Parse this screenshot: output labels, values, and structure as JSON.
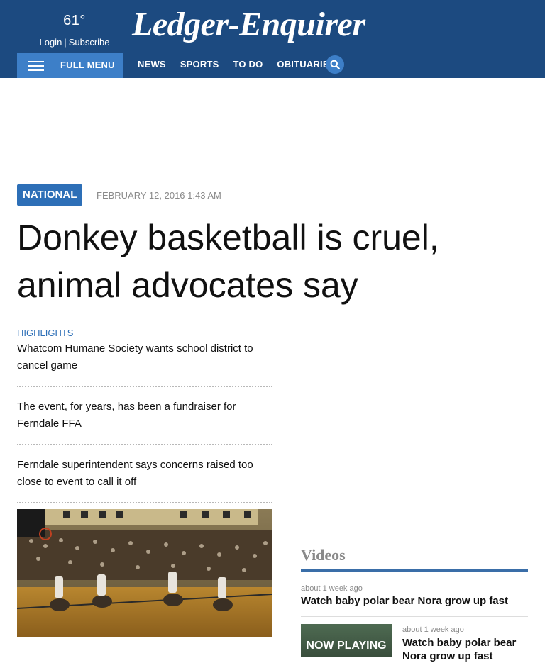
{
  "header": {
    "temperature": "61°",
    "login_label": "Login",
    "separator": "|",
    "subscribe_label": "Subscribe",
    "logo_text": "Ledger-Enquirer",
    "full_menu_label": "FULL MENU",
    "nav": [
      "NEWS",
      "SPORTS",
      "TO DO",
      "OBITUARIES"
    ],
    "brand_color": "#1c4a80",
    "accent_color": "#3d7fc8"
  },
  "article": {
    "section_tag": "NATIONAL",
    "date": "FEBRUARY 12, 2016 1:43 AM",
    "headline": "Donkey basketball is cruel, animal advocates say",
    "highlights_label": "HIGHLIGHTS",
    "highlights": [
      "Whatcom Humane Society wants school district to cancel game",
      "The event, for years, has been a fundraiser for Ferndale FFA",
      "Ferndale superintendent says concerns raised too close to event to call it off"
    ]
  },
  "videos": {
    "title": "Videos",
    "items": [
      {
        "ago": "about 1 week ago",
        "title": "Watch baby polar bear Nora grow up fast"
      },
      {
        "ago": "about 1 week ago",
        "title": "Watch baby polar bear Nora grow up fast",
        "overlay": "NOW PLAYING"
      }
    ]
  }
}
